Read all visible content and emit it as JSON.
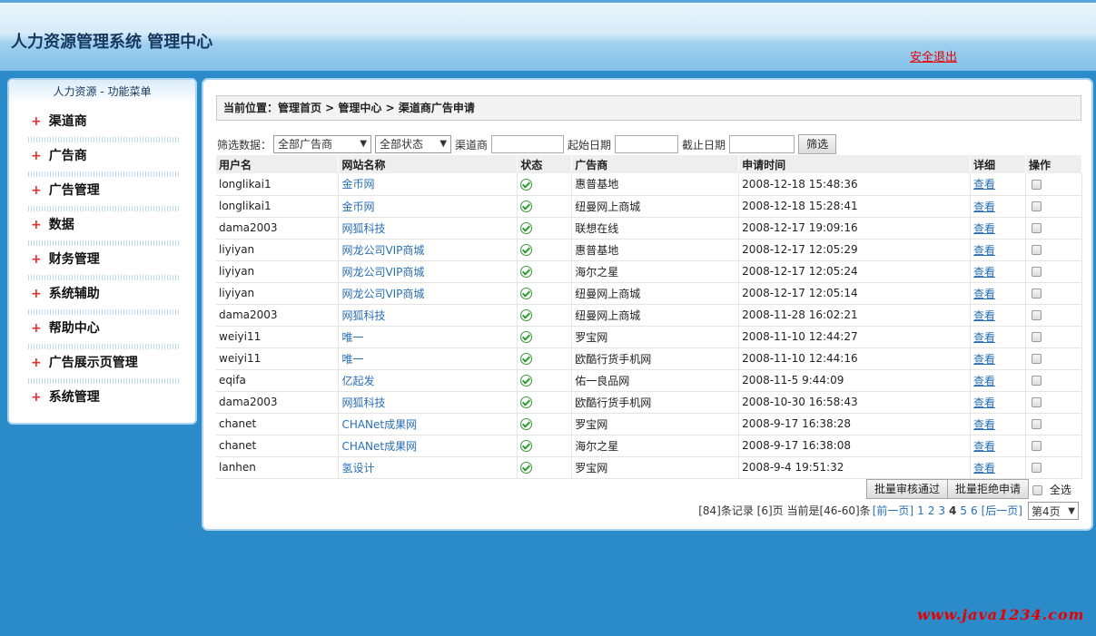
{
  "header": {
    "title": "人力资源管理系统 管理中心",
    "logout": "安全退出"
  },
  "sidebar": {
    "heading": "人力资源 - 功能菜单",
    "items": [
      {
        "label": "渠道商"
      },
      {
        "label": "广告商"
      },
      {
        "label": "广告管理"
      },
      {
        "label": "数据"
      },
      {
        "label": "财务管理"
      },
      {
        "label": "系统辅助"
      },
      {
        "label": "帮助中心"
      },
      {
        "label": "广告展示页管理"
      },
      {
        "label": "系统管理"
      }
    ]
  },
  "breadcrumb": "当前位置：管理首页 > 管理中心 > 渠道商广告申请",
  "filter": {
    "label": "筛选数据：",
    "advertiser_select": "全部广告商",
    "status_select": "全部状态",
    "channel_label": "渠道商",
    "start_label": "起始日期",
    "end_label": "截止日期",
    "button": "筛选"
  },
  "table": {
    "headers": [
      "用户名",
      "网站名称",
      "状态",
      "广告商",
      "申请时间",
      "详细",
      "操作"
    ],
    "view_label": "查看",
    "rows": [
      {
        "user": "longlikai1",
        "site": "金币网",
        "advertiser": "惠普基地",
        "time": "2008-12-18 15:48:36"
      },
      {
        "user": "longlikai1",
        "site": "金币网",
        "advertiser": "纽曼网上商城",
        "time": "2008-12-18 15:28:41"
      },
      {
        "user": "dama2003",
        "site": "网狐科技",
        "advertiser": "联想在线",
        "time": "2008-12-17 19:09:16"
      },
      {
        "user": "liyiyan",
        "site": "网龙公司VIP商城",
        "advertiser": "惠普基地",
        "time": "2008-12-17 12:05:29"
      },
      {
        "user": "liyiyan",
        "site": "网龙公司VIP商城",
        "advertiser": "海尔之星",
        "time": "2008-12-17 12:05:24"
      },
      {
        "user": "liyiyan",
        "site": "网龙公司VIP商城",
        "advertiser": "纽曼网上商城",
        "time": "2008-12-17 12:05:14"
      },
      {
        "user": "dama2003",
        "site": "网狐科技",
        "advertiser": "纽曼网上商城",
        "time": "2008-11-28 16:02:21"
      },
      {
        "user": "weiyi11",
        "site": "唯一",
        "advertiser": "罗宝网",
        "time": "2008-11-10 12:44:27"
      },
      {
        "user": "weiyi11",
        "site": "唯一",
        "advertiser": "欧酷行货手机网",
        "time": "2008-11-10 12:44:16"
      },
      {
        "user": "eqifa",
        "site": "亿起发",
        "advertiser": "佑一良品网",
        "time": "2008-11-5 9:44:09"
      },
      {
        "user": "dama2003",
        "site": "网狐科技",
        "advertiser": "欧酷行货手机网",
        "time": "2008-10-30 16:58:43"
      },
      {
        "user": "chanet",
        "site": "CHANet成果网",
        "advertiser": "罗宝网",
        "time": "2008-9-17 16:38:28"
      },
      {
        "user": "chanet",
        "site": "CHANet成果网",
        "advertiser": "海尔之星",
        "time": "2008-9-17 16:38:08"
      },
      {
        "user": "lanhen",
        "site": "氢设计",
        "advertiser": "罗宝网",
        "time": "2008-9-4 19:51:32"
      }
    ]
  },
  "batch": {
    "approve": "批量审核通过",
    "reject": "批量拒绝申请",
    "select_all": "全选"
  },
  "pager": {
    "summary": "[84]条记录 [6]页 当前是[46-60]条",
    "prev": "[前一页]",
    "pages": [
      "1",
      "2",
      "3",
      "4",
      "5",
      "6"
    ],
    "current": "4",
    "next": "[后一页]",
    "select_value": "第4页"
  },
  "watermark": "www.java1234.com"
}
